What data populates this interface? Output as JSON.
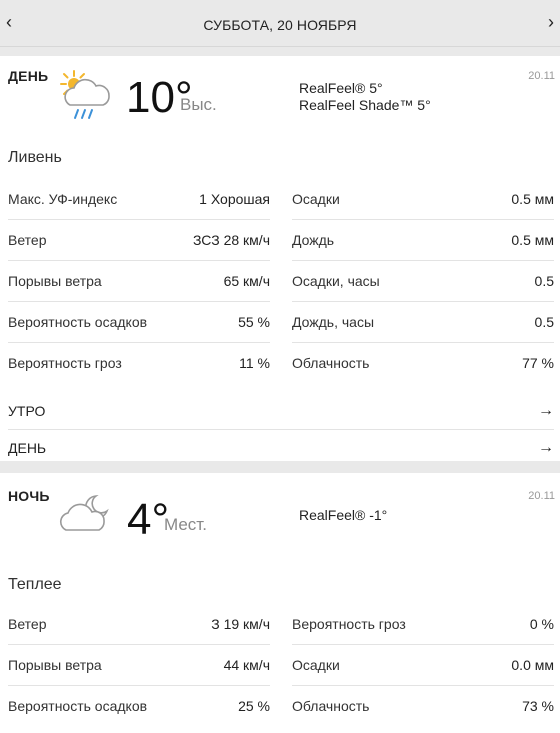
{
  "header": {
    "prev_icon": "‹",
    "next_icon": "›",
    "date": "СУББОТА, 20 НОЯБРЯ"
  },
  "day": {
    "label": "ДЕНЬ",
    "date_short": "20.11",
    "icon": "sun-cloud-rain-icon",
    "temp": "10°",
    "temp_kind": "Выс.",
    "realfeel": "RealFeel® 5°",
    "realfeel_shade": "RealFeel Shade™ 5°",
    "phrase": "Ливень",
    "left": [
      {
        "k": "Макс. УФ-индекс",
        "v": "1 Хорошая"
      },
      {
        "k": "Ветер",
        "v": "ЗСЗ 28 км/ч"
      },
      {
        "k": "Порывы ветра",
        "v": "65 км/ч"
      },
      {
        "k": "Вероятность осадков",
        "v": "55 %"
      },
      {
        "k": "Вероятность гроз",
        "v": "11 %"
      }
    ],
    "right": [
      {
        "k": "Осадки",
        "v": "0.5 мм"
      },
      {
        "k": "Дождь",
        "v": "0.5 мм"
      },
      {
        "k": "Осадки, часы",
        "v": "0.5"
      },
      {
        "k": "Дождь, часы",
        "v": "0.5"
      },
      {
        "k": "Облачность",
        "v": "77 %"
      }
    ],
    "links": [
      {
        "label": "УТРО",
        "arrow": "→"
      },
      {
        "label": "ДЕНЬ",
        "arrow": "→"
      }
    ]
  },
  "night": {
    "label": "НОЧЬ",
    "date_short": "20.11",
    "icon": "moon-cloud-icon",
    "temp": "4°",
    "temp_kind": "Мест.",
    "realfeel": "RealFeel® -1°",
    "phrase": "Теплее",
    "left": [
      {
        "k": "Ветер",
        "v": "З 19 км/ч"
      },
      {
        "k": "Порывы ветра",
        "v": "44 км/ч"
      },
      {
        "k": "Вероятность осадков",
        "v": "25 %"
      }
    ],
    "right": [
      {
        "k": "Вероятность гроз",
        "v": "0 %"
      },
      {
        "k": "Осадки",
        "v": "0.0 мм"
      },
      {
        "k": "Облачность",
        "v": "73 %"
      }
    ]
  }
}
